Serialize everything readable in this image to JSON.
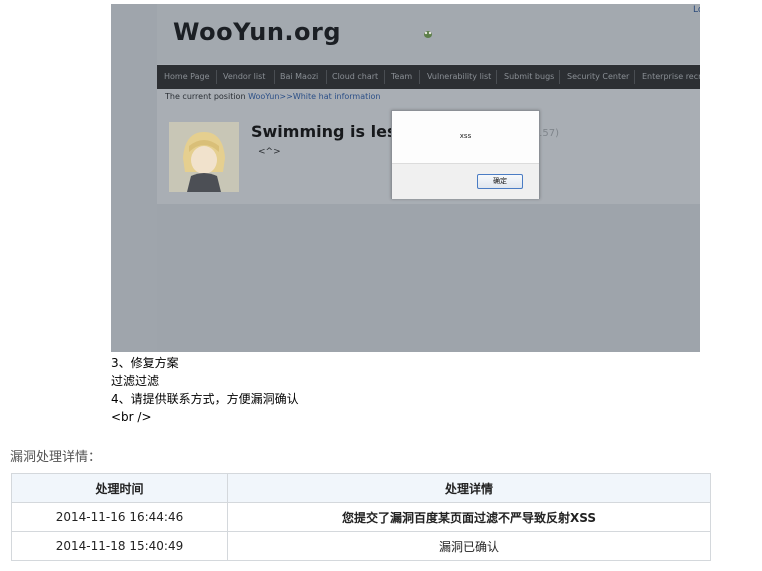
{
  "screenshot": {
    "login_label": "Lo",
    "logo": "WooYun.org",
    "nav": [
      "Home Page",
      "Vendor list",
      "Bai Maozi",
      "Cloud chart",
      "Team",
      "Vulnerability list",
      "Submit bugs",
      "Security Center",
      "Enterprise recr"
    ],
    "breadcrumb": {
      "prefix": "The current position ",
      "site": "WooYun",
      "sep": ">>",
      "page": "White hat information"
    },
    "profile": {
      "name": "Swimming is les",
      "count": "157)",
      "tagline": "<^>"
    },
    "alert": {
      "message": "xss",
      "ok_label": "确定"
    }
  },
  "report": {
    "lines": [
      "3、修复方案",
      "过滤过滤",
      "4、请提供联系方式，方便漏洞确认",
      "<br />"
    ]
  },
  "details": {
    "title": "漏洞处理详情：",
    "columns": [
      "处理时间",
      "处理详情"
    ],
    "rows": [
      {
        "time": "2014-11-16 16:44:46",
        "detail": "您提交了漏洞百度某页面过滤不严导致反射XSS"
      },
      {
        "time": "2014-11-18 15:40:49",
        "detail": "漏洞已确认"
      }
    ]
  }
}
